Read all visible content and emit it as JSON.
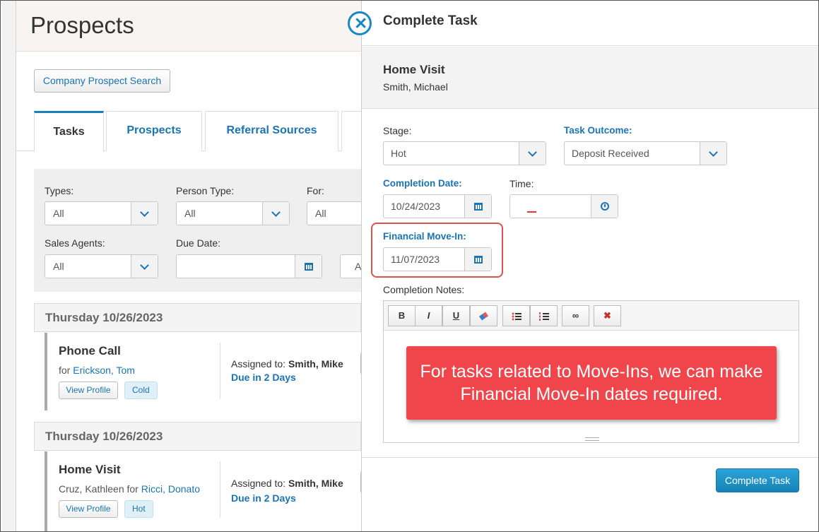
{
  "left": {
    "page_title": "Prospects",
    "company_search": "Company Prospect Search",
    "tabs": [
      "Tasks",
      "Prospects",
      "Referral Sources"
    ],
    "active_tab": "Tasks",
    "filters": {
      "types": {
        "label": "Types:",
        "value": "All"
      },
      "person_type": {
        "label": "Person Type:",
        "value": "All"
      },
      "for": {
        "label": "For:",
        "value": "All"
      },
      "sales_agents": {
        "label": "Sales Agents:",
        "value": "All"
      },
      "due_date": {
        "label": "Due Date:",
        "value": ""
      },
      "partial_next": "A"
    },
    "groups": [
      {
        "date": "Thursday 10/26/2023",
        "task": {
          "title": "Phone Call",
          "for_prefix": "for ",
          "person_prefix": "",
          "person": "Erickson, Tom",
          "view_profile": "View Profile",
          "badge": "Cold",
          "assigned_label": "Assigned to:",
          "assigned_to": "Smith, Mike",
          "due": "Due in 2 Days"
        }
      },
      {
        "date": "Thursday 10/26/2023",
        "task": {
          "title": "Home Visit",
          "for_prefix": " for ",
          "person_prefix": "Cruz, Kathleen",
          "person": "Ricci, Donato",
          "view_profile": "View Profile",
          "badge": "Hot",
          "assigned_label": "Assigned to:",
          "assigned_to": "Smith, Mike",
          "due": "Due in 2 Days"
        }
      }
    ]
  },
  "panel": {
    "title": "Complete Task",
    "summary_title": "Home Visit",
    "summary_person": "Smith, Michael",
    "stage": {
      "label": "Stage:",
      "value": "Hot"
    },
    "task_outcome": {
      "label": "Task Outcome:",
      "value": "Deposit Received"
    },
    "completion_date": {
      "label": "Completion Date:",
      "value": "10/24/2023"
    },
    "time": {
      "label": "Time:",
      "value": ""
    },
    "financial_move_in": {
      "label": "Financial Move-In:",
      "value": "11/07/2023"
    },
    "notes_label": "Completion Notes:",
    "toolbar": {
      "bold": "B",
      "italic": "I",
      "underline": "U"
    },
    "callout": "For tasks related to Move-Ins, we can make Financial Move-In dates required.",
    "complete_button": "Complete Task"
  },
  "colors": {
    "accent": "#1a74b5",
    "callout": "#f0464b",
    "primary_button": "#1a96cf",
    "highlight_border": "#d9534f"
  }
}
